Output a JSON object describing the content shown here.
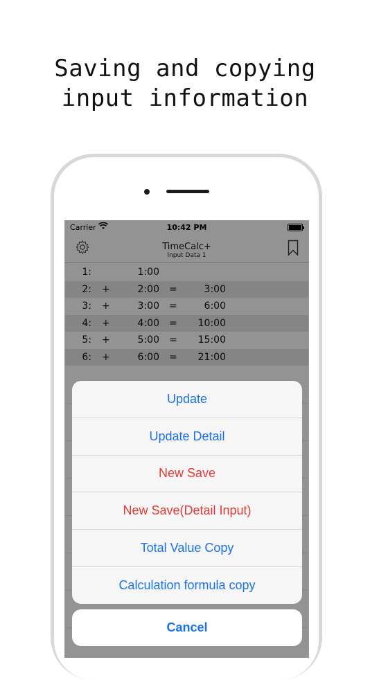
{
  "headline": {
    "line1": "Saving and copying",
    "line2": "input information"
  },
  "status_bar": {
    "carrier": "Carrier",
    "time": "10:42 PM"
  },
  "navbar": {
    "title": "TimeCalc+",
    "subtitle": "Input Data 1",
    "left_icon": "gear-icon",
    "right_icon": "bookmark-icon"
  },
  "rows": [
    {
      "index": "1:",
      "op": "",
      "value": "1:00",
      "eq": "",
      "result": ""
    },
    {
      "index": "2:",
      "op": "+",
      "value": "2:00",
      "eq": "=",
      "result": "3:00"
    },
    {
      "index": "3:",
      "op": "+",
      "value": "3:00",
      "eq": "=",
      "result": "6:00"
    },
    {
      "index": "4:",
      "op": "+",
      "value": "4:00",
      "eq": "=",
      "result": "10:00"
    },
    {
      "index": "5:",
      "op": "+",
      "value": "5:00",
      "eq": "=",
      "result": "15:00"
    },
    {
      "index": "6:",
      "op": "+",
      "value": "6:00",
      "eq": "=",
      "result": "21:00"
    }
  ],
  "action_sheet": {
    "actions": [
      {
        "label": "Update",
        "style": "default"
      },
      {
        "label": "Update Detail",
        "style": "default"
      },
      {
        "label": "New Save",
        "style": "destructive"
      },
      {
        "label": "New Save(Detail Input)",
        "style": "destructive"
      },
      {
        "label": "Total Value Copy",
        "style": "default"
      },
      {
        "label": "Calculation formula copy",
        "style": "default"
      }
    ],
    "cancel_label": "Cancel"
  },
  "colors": {
    "accent": "#1a73e8",
    "destructive": "#e53935"
  }
}
